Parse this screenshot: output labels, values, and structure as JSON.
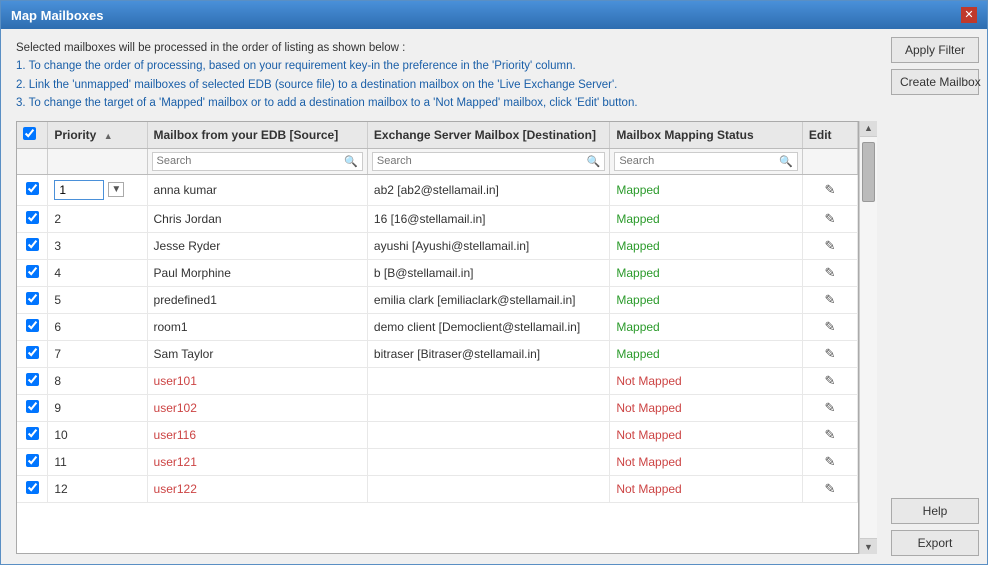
{
  "window": {
    "title": "Map Mailboxes"
  },
  "instructions": {
    "intro": "Selected mailboxes will be processed in the order of listing as shown below :",
    "step1": "1. To change the order of processing, based on your requirement key-in the preference in the 'Priority' column.",
    "step2": "2. Link the 'unmapped' mailboxes of selected EDB (source file) to a destination mailbox on the 'Live Exchange Server'.",
    "step3": "3. To change the target of a 'Mapped' mailbox or to add a destination mailbox to a 'Not Mapped' mailbox, click 'Edit' button."
  },
  "table": {
    "columns": {
      "checkbox": "",
      "priority": "Priority",
      "source": "Mailbox from your EDB [Source]",
      "destination": "Exchange Server Mailbox [Destination]",
      "status": "Mailbox Mapping Status",
      "edit": "Edit"
    },
    "search_placeholders": {
      "source": "Search",
      "destination": "Search",
      "status": "Search"
    },
    "rows": [
      {
        "id": 1,
        "priority": "1",
        "source": "anna kumar",
        "destination": "ab2 [ab2@stellamail.in]",
        "status": "Mapped",
        "mapped": true
      },
      {
        "id": 2,
        "priority": "2",
        "source": "Chris Jordan",
        "destination": "16 [16@stellamail.in]",
        "status": "Mapped",
        "mapped": true
      },
      {
        "id": 3,
        "priority": "3",
        "source": "Jesse Ryder",
        "destination": "ayushi [Ayushi@stellamail.in]",
        "status": "Mapped",
        "mapped": true
      },
      {
        "id": 4,
        "priority": "4",
        "source": "Paul Morphine",
        "destination": "b [B@stellamail.in]",
        "status": "Mapped",
        "mapped": true
      },
      {
        "id": 5,
        "priority": "5",
        "source": "predefined1",
        "destination": "emilia clark [emiliaclark@stellamail.in]",
        "status": "Mapped",
        "mapped": true
      },
      {
        "id": 6,
        "priority": "6",
        "source": "room1",
        "destination": "demo client [Democlient@stellamail.in]",
        "status": "Mapped",
        "mapped": true
      },
      {
        "id": 7,
        "priority": "7",
        "source": "Sam Taylor",
        "destination": "bitraser [Bitraser@stellamail.in]",
        "status": "Mapped",
        "mapped": true
      },
      {
        "id": 8,
        "priority": "8",
        "source": "user101",
        "destination": "",
        "status": "Not Mapped",
        "mapped": false
      },
      {
        "id": 9,
        "priority": "9",
        "source": "user102",
        "destination": "",
        "status": "Not Mapped",
        "mapped": false
      },
      {
        "id": 10,
        "priority": "10",
        "source": "user116",
        "destination": "",
        "status": "Not Mapped",
        "mapped": false
      },
      {
        "id": 11,
        "priority": "11",
        "source": "user121",
        "destination": "",
        "status": "Not Mapped",
        "mapped": false
      },
      {
        "id": 12,
        "priority": "12",
        "source": "user122",
        "destination": "",
        "status": "Not Mapped",
        "mapped": false
      }
    ]
  },
  "buttons": {
    "apply_filter": "Apply Filter",
    "create_mailbox": "Create Mailbox",
    "help": "Help",
    "export": "Export"
  },
  "icons": {
    "close": "✕",
    "search": "🔍",
    "sort_asc": "▲",
    "edit": "✎",
    "scroll_up": "▲",
    "scroll_down": "▼",
    "dropdown": "▼"
  }
}
